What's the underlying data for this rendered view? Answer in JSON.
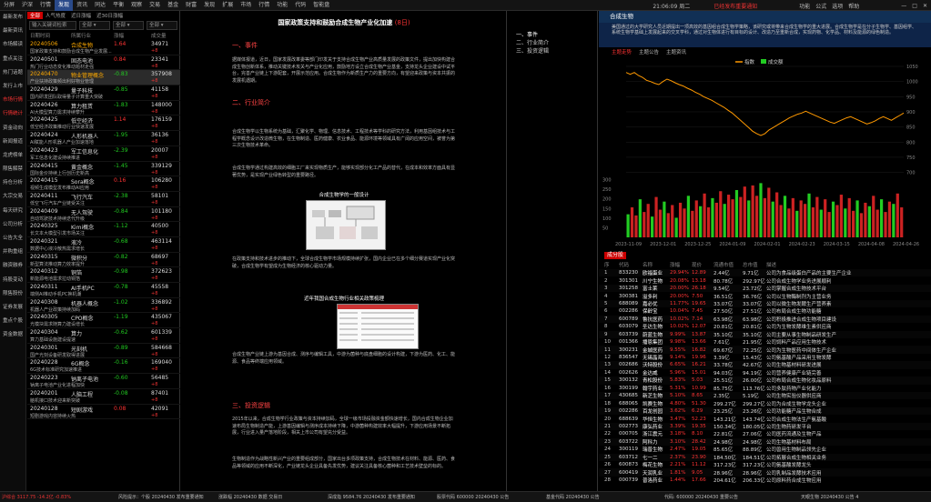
{
  "topbar": {
    "menu": [
      "分屏",
      "沪深",
      "行情",
      "发现",
      "资讯",
      "同达",
      "平衡",
      "观察",
      "交易",
      "基金",
      "财富",
      "发现",
      "扩展",
      "市场",
      "行情",
      "功能",
      "代码",
      "智能盘"
    ],
    "active_index": 3,
    "clock": "21:06:09 周二",
    "alert": "已经发布重要通知",
    "right_items": [
      "功能",
      "公式",
      "选项",
      "帮助"
    ]
  },
  "leftnav": [
    "最新发布",
    "最新资讯",
    "市场解读",
    "重点关注",
    "热门话题",
    "发行上市",
    "市场行情",
    "行情统计",
    "资金动向",
    "新闻报道",
    "龙虎榜单",
    "限售解禁",
    "持仓分析",
    "大宗交易",
    "每天研究",
    "公司分析",
    "公告大全",
    "并购重组",
    "融资融券",
    "持股变动",
    "限售股份",
    "证券发展",
    "重点个股",
    "资金数据"
  ],
  "leftnav_active": [
    6,
    7
  ],
  "listpanel": {
    "tabs": [
      "全部",
      "人气热度",
      "近日涨幅",
      "近30日涨幅"
    ],
    "active_tab": 0,
    "search_placeholder": "输入关键词检索",
    "filters": [
      "全部",
      "全部",
      "全部"
    ],
    "headers": [
      "日期时间",
      "所属行业",
      "涨幅",
      "成交量"
    ],
    "rows": [
      {
        "date": "20240506",
        "name": "合成生物",
        "pct": "1.64",
        "vol": "34971",
        "desc": "国家政策支持和鼓励合成生物产业发展...",
        "chg": "+8",
        "up": true,
        "orange": true
      },
      {
        "date": "20240501",
        "name": "固态电池",
        "pct": "0.84",
        "vol": "23341",
        "desc": "热门行业动态变化推动题材走强",
        "chg": "+8",
        "up": true
      },
      {
        "date": "20240470",
        "name": "物业管理概念",
        "pct": "-0.83",
        "vol": "357908",
        "desc": "产业扶持政策频出利好物业管理",
        "chg": "+8",
        "up": false,
        "orange": true
      },
      {
        "date": "20240429",
        "name": "量子科技",
        "pct": "-0.85",
        "vol": "41158",
        "desc": "国内研发团队取得量子计算重大突破",
        "chg": "+8",
        "up": false
      },
      {
        "date": "20240426",
        "name": "算力租赁",
        "pct": "-1.83",
        "vol": "148000",
        "desc": "AI大模型算力需求持续攀升",
        "chg": "+8",
        "up": false
      },
      {
        "date": "20240425",
        "name": "低空经济",
        "pct": "1.14",
        "vol": "176159",
        "desc": "低空经济政策推动行业快速发展",
        "chg": "+8",
        "up": true
      },
      {
        "date": "20240424",
        "name": "人形机器人",
        "pct": "-1.95",
        "vol": "36136",
        "desc": "AI赋能人形机器人产业加速落地",
        "chg": "+8",
        "up": false
      },
      {
        "date": "20240423",
        "name": "军工信息化",
        "pct": "-2.39",
        "vol": "20007",
        "desc": "军工信息化建设持续推进",
        "chg": "+8",
        "up": false
      },
      {
        "date": "20240415",
        "name": "黄金概念",
        "pct": "-1.45",
        "vol": "339129",
        "desc": "国际金价持续上行创历史新高",
        "chg": "+8",
        "up": false
      },
      {
        "date": "20240415",
        "name": "Sora概念",
        "pct": "0.16",
        "vol": "106280",
        "desc": "视频生成模型发布推动AI应用",
        "chg": "+8",
        "up": true
      },
      {
        "date": "20240411",
        "name": "飞行汽车",
        "pct": "-2.38",
        "vol": "58101",
        "desc": "低空飞行汽车产业链受关注",
        "chg": "+8",
        "up": false
      },
      {
        "date": "20240409",
        "name": "无人驾驶",
        "pct": "-0.84",
        "vol": "101180",
        "desc": "自动驾驶技术持续迭代升级",
        "chg": "+8",
        "up": false
      },
      {
        "date": "20240325",
        "name": "Kimi概念",
        "pct": "-1.12",
        "vol": "40500",
        "desc": "长文本大模型引发市场关注",
        "chg": "+8",
        "up": false
      },
      {
        "date": "20240321",
        "name": "液冷",
        "pct": "-0.68",
        "vol": "463114",
        "desc": "数据中心液冷散热需求增长",
        "chg": "+8",
        "up": false
      },
      {
        "date": "20240315",
        "name": "微积分",
        "pct": "-0.82",
        "vol": "68697",
        "desc": "新型算法推动算力效率提升",
        "chg": "+8",
        "up": false
      },
      {
        "date": "20240312",
        "name": "铜箔",
        "pct": "-0.98",
        "vol": "372623",
        "desc": "新能源电池需求拉动铜箔",
        "chg": "+8",
        "up": false
      },
      {
        "date": "20240311",
        "name": "AI手机PC",
        "pct": "-0.78",
        "vol": "45558",
        "desc": "端侧AI推动手机PC换机潮",
        "chg": "+8",
        "up": false
      },
      {
        "date": "20240308",
        "name": "机器人概念",
        "pct": "-1.02",
        "vol": "336892",
        "desc": "机器人产业政策持续加码",
        "chg": "+8",
        "up": false
      },
      {
        "date": "20240305",
        "name": "CPO概念",
        "pct": "-1.19",
        "vol": "435067",
        "desc": "光模块需求随算力建设增长",
        "chg": "+8",
        "up": false
      },
      {
        "date": "20240304",
        "name": "算力",
        "pct": "-0.62",
        "vol": "601339",
        "desc": "算力基础设施建设提速",
        "chg": "+8",
        "up": false
      },
      {
        "date": "20240301",
        "name": "光刻机",
        "pct": "-0.89",
        "vol": "584668",
        "desc": "国产光刻设备研发取得进展",
        "chg": "+8",
        "up": false
      },
      {
        "date": "20240228",
        "name": "6G概念",
        "pct": "-0.16",
        "vol": "169040",
        "desc": "6G技术标准研究加速推进",
        "chg": "+8",
        "up": false
      },
      {
        "date": "20240223",
        "name": "钠离子电池",
        "pct": "-0.60",
        "vol": "56485",
        "desc": "钠离子电池产业化进程加快",
        "chg": "+8",
        "up": false
      },
      {
        "date": "20240201",
        "name": "人脑工程",
        "pct": "-0.08",
        "vol": "87401",
        "desc": "脑机接口技术迎来新突破",
        "chg": "+8",
        "up": false
      },
      {
        "date": "20240128",
        "name": "短剧游戏",
        "pct": "0.08",
        "vol": "42091",
        "desc": "短剧游戏内容持续火热",
        "chg": "+8",
        "up": true
      }
    ]
  },
  "article": {
    "title": "国家政策支持和鼓励合成生物产业化加速",
    "title_tag": "(8日)",
    "sections": [
      {
        "heading": "一、事件",
        "paras": [
          "据媒体报道，近日，国家发展改革委等部门印发关于支持合成生物产业高质量发展的政策文件，提出加快构建合成生物创新体系，推动关键技术攻关与产业化应用，鼓励地方设立合成生物产业基金，支持龙头企业建设中试平台，完善产业链上下游配套，开展示范应用。合成生物作为新质生产力的重要方向，有望迎来政策与资本共振的发展机遇期。"
        ]
      },
      {
        "heading": "二、行业简介",
        "paras": [
          "合成生物学以生物系统为基础，汇聚化学、物理、信息技术、工程技术等学科的研究方法，利用基因组技术与工程学概念设计改造微生物，在生物制造、医药健康、农业食品、能源环境等领域具有广阔的应用空间，被誉为第三次生物技术革命。",
          "合成生物学通过构建高效的细胞工厂来实现物质生产，能够实现部分化工产品的替代，在成本和效率方面具有显著优势，是实现产业绿色转型的重要路径。"
        ]
      },
      {
        "heading": "三、投资逻辑",
        "paras": [
          "2015年以来，合成生物学行业政策与资本持续加码，全球一级市场投融资金额快速增长，国内合成生物企业加速布局生物制造产能，上游基因编辑与测序成本持续下降，中游菌种构建效率大幅提升，下游应用场景不断拓展，行业进入量产落地阶段，相关上市公司有望充分受益。",
          "生物制造作为战略性新兴产业的重要组成部分，国家出台多项政策支持，合成生物技术在材料、能源、医药、食品等领域的应用不断深化，产业链龙头企业具备先发优势，建议关注具备核心菌种和工艺技术壁垒的标的。"
        ]
      }
    ],
    "fig1_caption": "合成生物学的一般设计",
    "fig2_caption": "近年我国合成生物行业相关政策梳理"
  },
  "toc": [
    "一、事件",
    "二、行业简介",
    "三、投资逻辑"
  ],
  "right": {
    "title": "合成生物",
    "desc": "美国通过的大学研究人员近期提出一项高效的基因组合成生物学策略，该研究或将带来合成生物学的重大进展。合成生物学是在分子生物学、基因组学、系统生物学基础上发展起来的交叉学科，通过对生物体进行有目标的设计、改造乃至重新合成，实现药物、化学品、材料及能源的绿色制造。",
    "tabs": [
      "主题走势",
      "主题公告",
      "主题资讯"
    ],
    "legend": [
      "指数",
      "成交额"
    ],
    "grid_tag": "成分股",
    "table_headers": [
      "序",
      "代码",
      "名称",
      "涨幅",
      "现价",
      "流通市值",
      "总市值",
      "描述"
    ],
    "table_rows": [
      [
        "1",
        "833230",
        "欧福蛋业",
        "29.94%",
        "12.89",
        "2.44亿",
        "9.71亿",
        "公司为食品级蛋白产品的主要生产企业"
      ],
      [
        "2",
        "301301",
        "川宁生物",
        "20.08%",
        "13.18",
        "80.78亿",
        "292.97亿",
        "公司合成生物学业务进展顺利"
      ],
      [
        "3",
        "301258",
        "富士莱",
        "20.00%",
        "26.18",
        "9.54亿",
        "23.72亿",
        "公司掌握合成生物技术平台"
      ],
      [
        "4",
        "300381",
        "溢多利",
        "20.00%",
        "7.50",
        "36.51亿",
        "36.76亿",
        "公司以生物酶制剂为主营业务"
      ],
      [
        "5",
        "688089",
        "嘉必优",
        "11.77%",
        "19.65",
        "33.07亿",
        "33.07亿",
        "公司以微生物发酵生产营养素"
      ],
      [
        "6",
        "002286",
        "保龄宝",
        "10.04%",
        "7.45",
        "27.50亿",
        "27.51亿",
        "公司布局合成生物功能糖"
      ],
      [
        "7",
        "600789",
        "鲁抗医药",
        "10.02%",
        "7.14",
        "63.98亿",
        "63.98亿",
        "公司积极推进合成生物项目建设"
      ],
      [
        "8",
        "603079",
        "圣达生物",
        "10.02%",
        "12.07",
        "20.81亿",
        "20.81亿",
        "公司为生物发酵维生素供应商"
      ],
      [
        "9",
        "603739",
        "蔚蓝生物",
        "9.99%",
        "13.87",
        "35.10亿",
        "35.10亿",
        "公司主要从事生物制品研发生产"
      ],
      [
        "10",
        "001366",
        "播恩集团",
        "9.98%",
        "13.66",
        "7.61亿",
        "21.95亿",
        "公司饲料产品应用生物技术"
      ],
      [
        "11",
        "300231",
        "金城医药",
        "9.55%",
        "16.82",
        "69.67亿",
        "72.25亿",
        "公司为生物医药中间体生产企业"
      ],
      [
        "12",
        "836547",
        "无锡晶海",
        "9.14%",
        "19.96",
        "3.39亿",
        "15.43亿",
        "公司氨基酸产品采用生物发酵"
      ],
      [
        "13",
        "002686",
        "沃特股份",
        "6.65%",
        "16.21",
        "33.78亿",
        "42.67亿",
        "公司生物基材料研发进展"
      ],
      [
        "14",
        "002626",
        "金达威",
        "5.96%",
        "15.01",
        "94.03亿",
        "94.19亿",
        "公司营养健康产业链完善"
      ],
      [
        "15",
        "300132",
        "青松股份",
        "5.83%",
        "5.03",
        "25.51亿",
        "26.00亿",
        "公司布局合成生物化妆品原料"
      ],
      [
        "16",
        "300199",
        "翰宇药业",
        "5.31%",
        "10.99",
        "85.75亿",
        "113.76亿",
        "公司多肽药物产业化能力"
      ],
      [
        "17",
        "430685",
        "新芝生物",
        "5.10%",
        "8.65",
        "2.35亿",
        "5.19亿",
        "公司生物实验仪器供应商"
      ],
      [
        "18",
        "688065",
        "凯赛生物",
        "4.80%",
        "51.30",
        "299.27亿",
        "299.27亿",
        "公司为合成生物学龙头企业"
      ],
      [
        "19",
        "002286",
        "百龙创园",
        "3.62%",
        "6.29",
        "23.25亿",
        "23.26亿",
        "公司功能糖产品生物合成"
      ],
      [
        "20",
        "688639",
        "华恒生物",
        "3.47%",
        "52.23",
        "143.21亿",
        "143.74亿",
        "公司合成生物法生产氨基酸"
      ],
      [
        "21",
        "002773",
        "康弘药业",
        "3.39%",
        "19.35",
        "150.34亿",
        "180.05亿",
        "公司生物药研发平台"
      ],
      [
        "22",
        "000705",
        "浙江震元",
        "3.18%",
        "8.10",
        "22.81亿",
        "27.06亿",
        "公司医药流通及生物产品"
      ],
      [
        "23",
        "603722",
        "阿科力",
        "3.10%",
        "28.42",
        "24.98亿",
        "24.98亿",
        "公司生物基材料布局"
      ],
      [
        "24",
        "300119",
        "瑞普生物",
        "2.47%",
        "19.05",
        "85.65亿",
        "88.89亿",
        "公司兽用生物制品领先企业"
      ],
      [
        "25",
        "603712",
        "七一二",
        "2.37%",
        "23.90",
        "184.50亿",
        "184.51亿",
        "公司拓展合成生物相关业务"
      ],
      [
        "26",
        "600873",
        "梅花生物",
        "2.21%",
        "11.12",
        "317.23亿",
        "317.23亿",
        "公司氨基酸发酵龙头"
      ],
      [
        "27",
        "600419",
        "天润乳业",
        "1.81%",
        "9.05",
        "28.96亿",
        "28.96亿",
        "公司乳制品发酵技术应用"
      ],
      [
        "28",
        "000739",
        "普洛药业",
        "1.44%",
        "17.66",
        "204.61亿",
        "206.33亿",
        "公司原料药合成生物应用"
      ]
    ]
  },
  "chart_data": {
    "type": "line",
    "x_labels": [
      "2023-11-09",
      "2023-12-01",
      "2023-12-25",
      "2024-01-09",
      "2024-02-01",
      "2024-02-23",
      "2024-03-15",
      "2024-04-08",
      "2024-04-26"
    ],
    "series": [
      {
        "name": "指数",
        "values": [
          1030,
          1024,
          1030,
          1020,
          1014,
          1004,
          1000,
          994,
          990,
          1000,
          1008,
          1003,
          996,
          990,
          985,
          978,
          972,
          964,
          958,
          950,
          944,
          938,
          930,
          922,
          915,
          905,
          896,
          884,
          872,
          860,
          848,
          836,
          828,
          822,
          828,
          840,
          848,
          856,
          864,
          872,
          880,
          886,
          892,
          896,
          902,
          896,
          890,
          884,
          878,
          872,
          866,
          862,
          868,
          874,
          880,
          884,
          878,
          872,
          866,
          860,
          864,
          870,
          878,
          884,
          878,
          872,
          880,
          888,
          896
        ]
      },
      {
        "name": "成交额",
        "values": [
          40,
          52,
          38,
          66,
          44,
          58,
          36,
          70,
          48,
          62,
          42,
          56,
          34,
          60,
          50,
          72,
          46,
          64,
          54,
          76,
          52,
          68,
          60,
          80,
          58,
          74,
          66,
          82,
          70,
          88,
          64,
          90,
          72,
          94,
          68,
          86,
          62,
          78,
          56,
          72,
          50,
          68,
          46,
          64,
          58,
          76,
          52,
          70,
          48,
          66,
          44,
          62,
          56,
          74,
          50,
          68,
          46,
          64,
          42,
          60,
          54,
          72,
          48,
          66,
          44,
          62,
          58,
          76,
          52
        ]
      }
    ],
    "y_ticks_right": [
      1050,
      1000,
      950,
      900,
      850,
      800,
      750,
      700
    ],
    "y_ticks_left": [
      300,
      250,
      200,
      150,
      100,
      50
    ]
  },
  "status": [
    "沪综合 3117.75 -14.2亿  -0.83%",
    "风险提示：个股 20240430 发布重要通知",
    "涨跌幅 20240430 数据  交易日",
    "深成指 9584.76 20240430 发布重要通知",
    "股票代码 600000 20240430 公告",
    "基金代码 20240430 公告",
    "代码: 600000 20240430 重要公告",
    "天眼生物 20240430 公告 4"
  ]
}
